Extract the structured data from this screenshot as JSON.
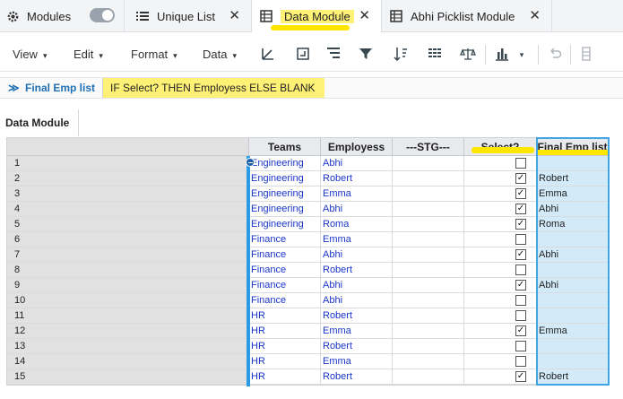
{
  "tabs": {
    "modules": {
      "label": "Modules"
    },
    "unique": {
      "label": "Unique List"
    },
    "data_module": {
      "label": "Data Module"
    },
    "abhi": {
      "label": "Abhi Picklist Module"
    },
    "close_glyph": "✕"
  },
  "toolbar": {
    "menus": [
      "View",
      "Edit",
      "Format",
      "Data"
    ],
    "caret": "▾"
  },
  "formula": {
    "chevron": "≫",
    "line_item": "Final Emp list",
    "expression": "IF Select? THEN Employess ELSE BLANK"
  },
  "module_tab": {
    "label": "Data Module"
  },
  "grid": {
    "headers": {
      "teams": "Teams",
      "employess": "Employess",
      "stg": "---STG---",
      "select": "Select?",
      "final": "Final Emp list"
    },
    "rows": [
      {
        "num": "1",
        "team": "Engineering",
        "emp": "Abhi",
        "sel": false,
        "final": ""
      },
      {
        "num": "2",
        "team": "Engineering",
        "emp": "Robert",
        "sel": true,
        "final": "Robert"
      },
      {
        "num": "3",
        "team": "Engineering",
        "emp": "Emma",
        "sel": true,
        "final": "Emma"
      },
      {
        "num": "4",
        "team": "Engineering",
        "emp": "Abhi",
        "sel": true,
        "final": "Abhi"
      },
      {
        "num": "5",
        "team": "Engineering",
        "emp": "Roma",
        "sel": true,
        "final": "Roma"
      },
      {
        "num": "6",
        "team": "Finance",
        "emp": "Emma",
        "sel": false,
        "final": ""
      },
      {
        "num": "7",
        "team": "Finance",
        "emp": "Abhi",
        "sel": true,
        "final": "Abhi"
      },
      {
        "num": "8",
        "team": "Finance",
        "emp": "Robert",
        "sel": false,
        "final": ""
      },
      {
        "num": "9",
        "team": "Finance",
        "emp": "Abhi",
        "sel": true,
        "final": "Abhi"
      },
      {
        "num": "10",
        "team": "Finance",
        "emp": "Abhi",
        "sel": false,
        "final": ""
      },
      {
        "num": "11",
        "team": "HR",
        "emp": "Robert",
        "sel": false,
        "final": ""
      },
      {
        "num": "12",
        "team": "HR",
        "emp": "Emma",
        "sel": true,
        "final": "Emma"
      },
      {
        "num": "13",
        "team": "HR",
        "emp": "Robert",
        "sel": false,
        "final": ""
      },
      {
        "num": "14",
        "team": "HR",
        "emp": "Emma",
        "sel": false,
        "final": ""
      },
      {
        "num": "15",
        "team": "HR",
        "emp": "Robert",
        "sel": true,
        "final": "Robert"
      }
    ]
  },
  "colors": {
    "accent": "#1f6fb2",
    "highlight": "#ffe600",
    "final_col": "#d3eaf9",
    "link_text": "#1a35c9"
  }
}
